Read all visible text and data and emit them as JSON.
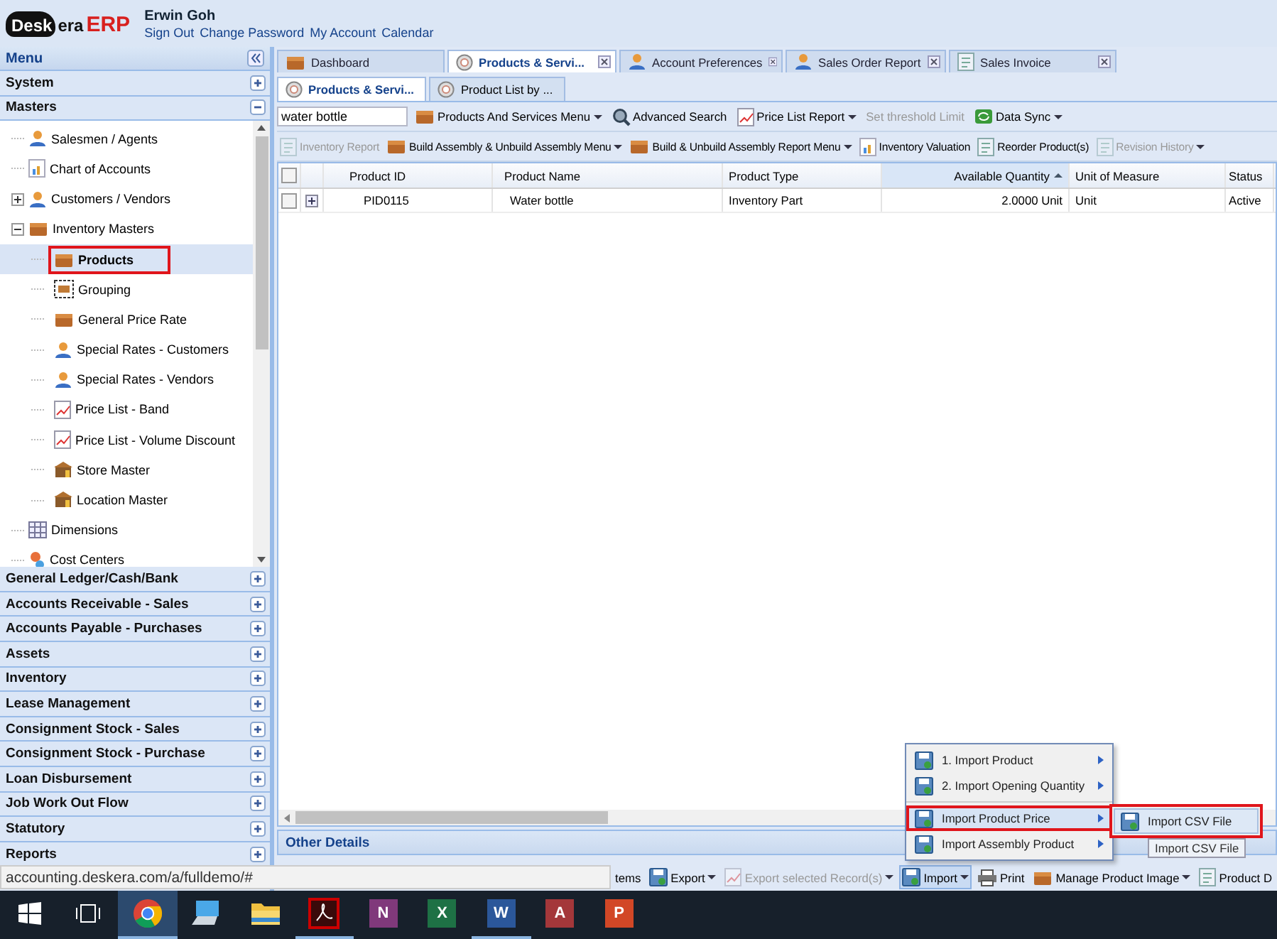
{
  "header": {
    "logo": {
      "cloud_text": "Desk",
      "text": "era",
      "suffix": "ERP"
    },
    "user": "Erwin Goh",
    "links": [
      "Sign Out",
      "Change Password",
      "My Account",
      "Calendar"
    ]
  },
  "menu": {
    "title": "Menu",
    "sections": [
      {
        "label": "System",
        "expanded": false
      },
      {
        "label": "Masters",
        "expanded": true,
        "items": [
          {
            "label": "Salesmen / Agents",
            "selected": false
          },
          {
            "label": "Chart of Accounts",
            "selected": false
          },
          {
            "label": "Customers / Vendors",
            "selected": false,
            "expanded": false
          },
          {
            "label": "Inventory Masters",
            "selected": false,
            "expanded": true,
            "children": [
              {
                "label": "Products",
                "selected": true,
                "annotated": true
              },
              {
                "label": "Grouping",
                "selected": false,
                "annotated": false
              },
              {
                "label": "General Price Rate",
                "selected": false,
                "annotated": false
              },
              {
                "label": "Special Rates - Customers",
                "selected": false,
                "annotated": false
              },
              {
                "label": "Special Rates - Vendors",
                "selected": false,
                "annotated": false
              },
              {
                "label": "Price List - Band",
                "selected": false,
                "annotated": false
              },
              {
                "label": "Price List - Volume Discount",
                "selected": false,
                "annotated": false
              },
              {
                "label": "Store Master",
                "selected": false,
                "annotated": false
              },
              {
                "label": "Location Master",
                "selected": false,
                "annotated": false
              }
            ]
          },
          {
            "label": "Dimensions",
            "selected": false
          },
          {
            "label": "Cost Centers",
            "selected": false
          }
        ]
      },
      {
        "label": "General Ledger/Cash/Bank",
        "expanded": false
      },
      {
        "label": "Accounts Receivable - Sales",
        "expanded": false
      },
      {
        "label": "Accounts Payable - Purchases",
        "expanded": false
      },
      {
        "label": "Assets",
        "expanded": false
      },
      {
        "label": "Inventory",
        "expanded": false
      },
      {
        "label": "Lease Management",
        "expanded": false
      },
      {
        "label": "Consignment Stock - Sales",
        "expanded": false
      },
      {
        "label": "Consignment Stock - Purchase",
        "expanded": false
      },
      {
        "label": "Loan Disbursement",
        "expanded": false
      },
      {
        "label": "Job Work Out Flow",
        "expanded": false
      },
      {
        "label": "Statutory",
        "expanded": false
      },
      {
        "label": "Reports",
        "expanded": false
      }
    ]
  },
  "tabs": [
    {
      "label": "Dashboard",
      "selected": false,
      "closable": false
    },
    {
      "label": "Products & Servi...",
      "selected": true,
      "closable": true
    },
    {
      "label": "Account Preferences",
      "selected": false,
      "closable": true
    },
    {
      "label": "Sales Order Report",
      "selected": false,
      "closable": true
    },
    {
      "label": "Sales Invoice",
      "selected": false,
      "closable": true
    }
  ],
  "subtabs": [
    {
      "label": "Products & Servi...",
      "selected": true
    },
    {
      "label": "Product List by ...",
      "selected": false
    }
  ],
  "search": {
    "value": "water bottle"
  },
  "toolbar_1": [
    {
      "label": "Products And Services Menu",
      "dropdown": true,
      "disabled": false
    },
    {
      "label": "Advanced Search",
      "dropdown": false,
      "disabled": false
    },
    {
      "label": "Price List Report",
      "dropdown": true,
      "disabled": false
    },
    {
      "label": "Set threshold Limit",
      "dropdown": false,
      "disabled": true
    },
    {
      "label": "Data Sync",
      "dropdown": true,
      "disabled": false
    }
  ],
  "toolbar_2": [
    {
      "label": "Inventory Report",
      "dropdown": false,
      "disabled": true
    },
    {
      "label": "Build Assembly & Unbuild Assembly Menu",
      "dropdown": true,
      "disabled": false
    },
    {
      "label": "Build & Unbuild Assembly Report Menu",
      "dropdown": true,
      "disabled": false
    },
    {
      "label": "Inventory Valuation",
      "dropdown": false,
      "disabled": false
    },
    {
      "label": "Reorder Product(s)",
      "dropdown": false,
      "disabled": false
    },
    {
      "label": "Revision History",
      "dropdown": true,
      "disabled": true
    }
  ],
  "table": {
    "all_checked": false,
    "columns": [
      {
        "label": "Product ID",
        "sorted": false
      },
      {
        "label": "Product Name",
        "sorted": false
      },
      {
        "label": "Product Type",
        "sorted": false
      },
      {
        "label": "Available Quantity",
        "sorted": true
      },
      {
        "label": "Unit of Measure",
        "sorted": false
      },
      {
        "label": "Status",
        "sorted": false
      }
    ],
    "rows": [
      {
        "checked": false,
        "expanded": false,
        "cells": [
          "PID0115",
          "Water bottle",
          "Inventory Part",
          "2.0000 Unit",
          "Unit",
          "Active"
        ]
      }
    ]
  },
  "details_panel": {
    "title": "Other Details"
  },
  "bottom_toolbar": [
    {
      "label": "tems",
      "dropdown": false,
      "disabled": false,
      "pressed": false
    },
    {
      "label": "Export",
      "dropdown": true,
      "disabled": false,
      "pressed": false
    },
    {
      "label": "Export selected Record(s)",
      "dropdown": true,
      "disabled": true,
      "pressed": false
    },
    {
      "label": "Import",
      "dropdown": true,
      "disabled": false,
      "pressed": true
    },
    {
      "label": "Print",
      "dropdown": false,
      "disabled": false,
      "pressed": false
    },
    {
      "label": "Manage Product Image",
      "dropdown": true,
      "disabled": false,
      "pressed": false
    },
    {
      "label": "Product D",
      "dropdown": false,
      "disabled": false,
      "pressed": false
    }
  ],
  "import_menu": {
    "items": [
      {
        "label": "1. Import Product",
        "selected": false,
        "annotated": false
      },
      {
        "label": "2. Import Opening Quantity",
        "selected": false,
        "annotated": false
      },
      {
        "label": "Import Product Price",
        "selected": true,
        "annotated": true
      },
      {
        "label": "Import Assembly Product",
        "selected": false,
        "annotated": false
      }
    ],
    "submenu": {
      "items": [
        {
          "label": "Import CSV File",
          "selected": true
        }
      ],
      "annotated": true
    },
    "tooltip": "Import CSV File"
  },
  "status_url": "accounting.deskera.com/a/fulldemo/#",
  "taskbar": [
    {
      "kind": "start",
      "active": false,
      "running": false
    },
    {
      "kind": "taskview",
      "active": false,
      "running": false
    },
    {
      "kind": "browser",
      "active": true,
      "running": true
    },
    {
      "kind": "computer",
      "active": false,
      "running": false
    },
    {
      "kind": "folder",
      "active": false,
      "running": false
    },
    {
      "kind": "pdf",
      "active": false,
      "running": true
    },
    {
      "kind": "tile",
      "label": "N",
      "color": "#80397b",
      "active": false,
      "running": false
    },
    {
      "kind": "tile",
      "label": "X",
      "color": "#1e7145",
      "active": false,
      "running": false
    },
    {
      "kind": "tile",
      "label": "W",
      "color": "#2b579a",
      "active": false,
      "running": true
    },
    {
      "kind": "tile",
      "label": "A",
      "color": "#a4373a",
      "active": false,
      "running": false
    },
    {
      "kind": "tile",
      "label": "P",
      "color": "#d24726",
      "active": false,
      "running": false
    }
  ]
}
